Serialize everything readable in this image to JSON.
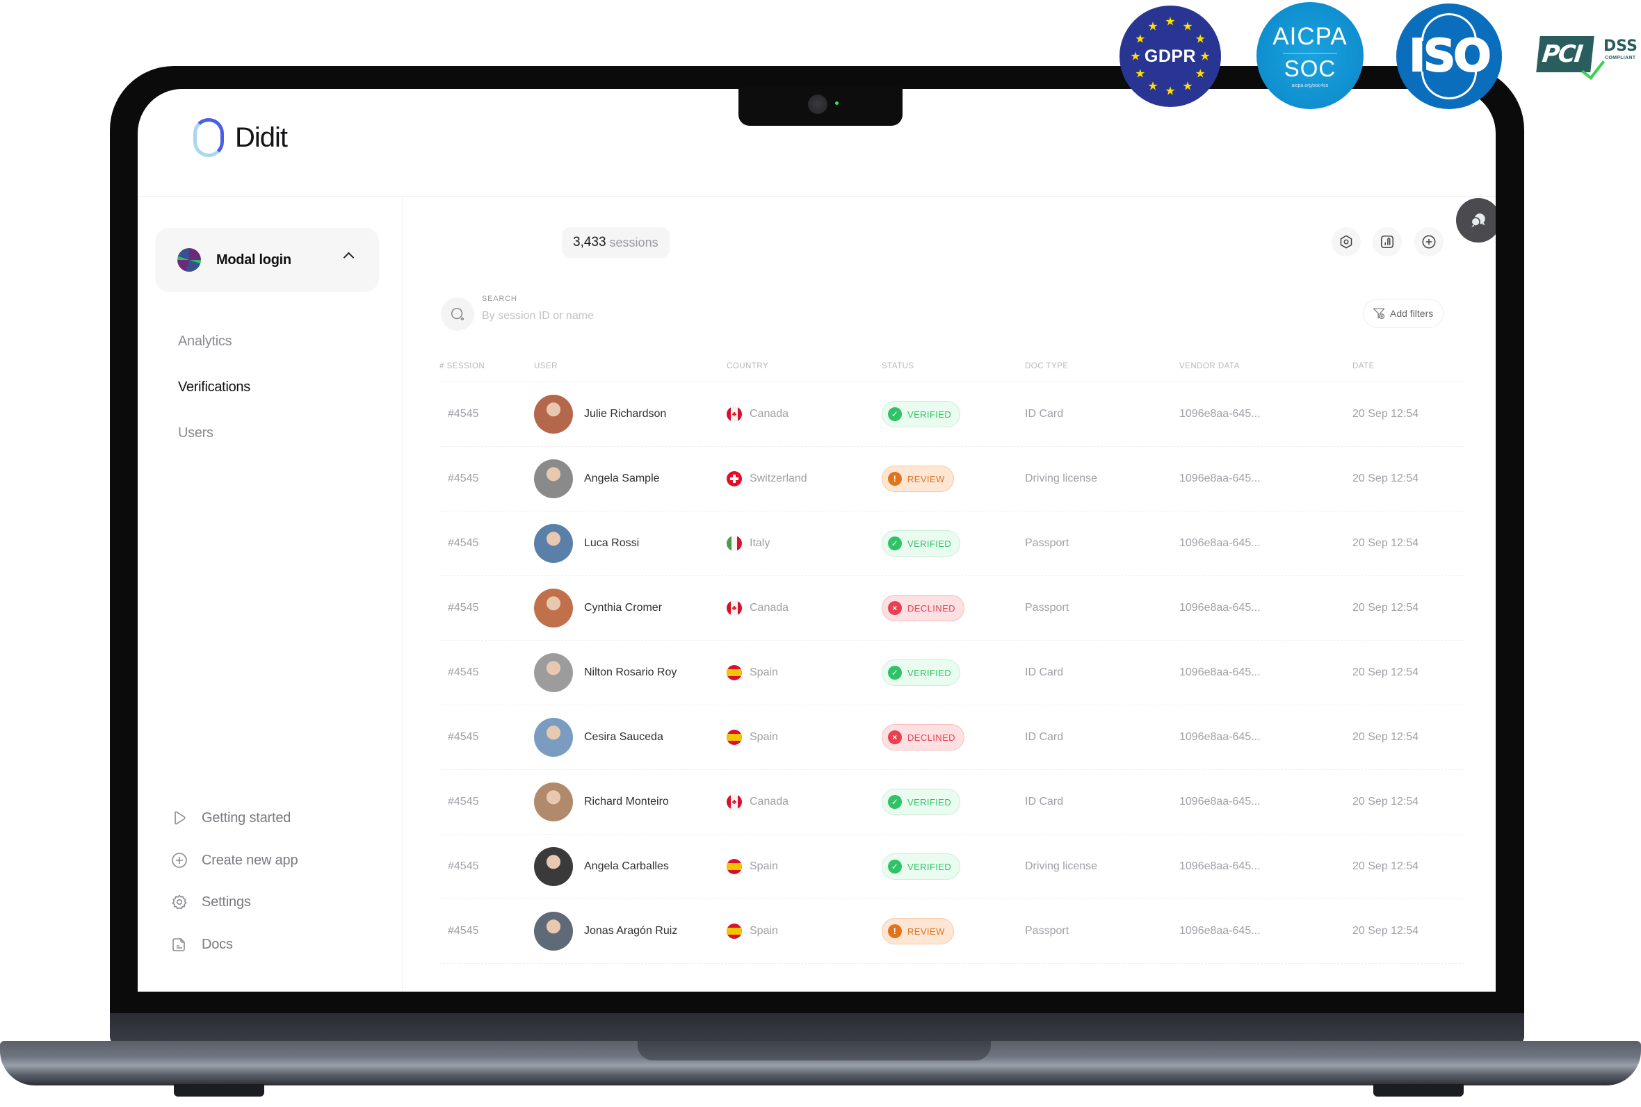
{
  "badges": {
    "gdpr": "GDPR",
    "aicpa_top": "AICPA",
    "aicpa_bottom": "SOC",
    "aicpa_url": "aicpa.org/soc4so",
    "iso": "ISO",
    "pci": "PCI",
    "pci_dss": "DSS",
    "pci_compliant": "COMPLIANT"
  },
  "brand": {
    "name": "Didit"
  },
  "sidebar": {
    "app_selector": {
      "name": "Modal login"
    },
    "nav": [
      {
        "label": "Analytics",
        "active": false
      },
      {
        "label": "Verifications",
        "active": true
      },
      {
        "label": "Users",
        "active": false
      }
    ],
    "bottom": [
      {
        "label": "Getting started",
        "icon": "play-icon"
      },
      {
        "label": "Create new app",
        "icon": "plus-circle-icon"
      },
      {
        "label": "Settings",
        "icon": "gear-icon"
      },
      {
        "label": "Docs",
        "icon": "document-icon"
      }
    ]
  },
  "main": {
    "sessions_count": "3,433",
    "sessions_label": "sessions",
    "search": {
      "label": "SEARCH",
      "placeholder": "By session ID or name",
      "value": ""
    },
    "add_filters_label": "Add filters",
    "columns": [
      "# SESSION",
      "USER",
      "COUNTRY",
      "STATUS",
      "DOC TYPE",
      "VENDOR DATA",
      "DATE"
    ],
    "rows": [
      {
        "session": "#4545",
        "user": "Julie Richardson",
        "country": "Canada",
        "flag": "ca",
        "status": "VERIFIED",
        "doc": "ID Card",
        "vendor": "1096e8aa-645...",
        "date": "20 Sep 12:54",
        "avatar_color": "#b4674a"
      },
      {
        "session": "#4545",
        "user": "Angela Sample",
        "country": "Switzerland",
        "flag": "ch",
        "status": "REVIEW",
        "doc": "Driving license",
        "vendor": "1096e8aa-645...",
        "date": "20 Sep 12:54",
        "avatar_color": "#8a8a8a"
      },
      {
        "session": "#4545",
        "user": "Luca Rossi",
        "country": "Italy",
        "flag": "it",
        "status": "VERIFIED",
        "doc": "Passport",
        "vendor": "1096e8aa-645...",
        "date": "20 Sep 12:54",
        "avatar_color": "#5a7fa8"
      },
      {
        "session": "#4545",
        "user": "Cynthia Cromer",
        "country": "Canada",
        "flag": "ca",
        "status": "DECLINED",
        "doc": "Passport",
        "vendor": "1096e8aa-645...",
        "date": "20 Sep 12:54",
        "avatar_color": "#c0704a"
      },
      {
        "session": "#4545",
        "user": "Nilton Rosario Roy",
        "country": "Spain",
        "flag": "es",
        "status": "VERIFIED",
        "doc": "ID Card",
        "vendor": "1096e8aa-645...",
        "date": "20 Sep 12:54",
        "avatar_color": "#9c9c9c"
      },
      {
        "session": "#4545",
        "user": "Cesira Sauceda",
        "country": "Spain",
        "flag": "es",
        "status": "DECLINED",
        "doc": "ID Card",
        "vendor": "1096e8aa-645...",
        "date": "20 Sep 12:54",
        "avatar_color": "#7a9cc0"
      },
      {
        "session": "#4545",
        "user": "Richard Monteiro",
        "country": "Canada",
        "flag": "ca",
        "status": "VERIFIED",
        "doc": "ID Card",
        "vendor": "1096e8aa-645...",
        "date": "20 Sep 12:54",
        "avatar_color": "#b08a6a"
      },
      {
        "session": "#4545",
        "user": "Angela Carballes",
        "country": "Spain",
        "flag": "es",
        "status": "VERIFIED",
        "doc": "Driving license",
        "vendor": "1096e8aa-645...",
        "date": "20 Sep 12:54",
        "avatar_color": "#3a3a3a"
      },
      {
        "session": "#4545",
        "user": "Jonas Aragón Ruiz",
        "country": "Spain",
        "flag": "es",
        "status": "REVIEW",
        "doc": "Passport",
        "vendor": "1096e8aa-645...",
        "date": "20 Sep 12:54",
        "avatar_color": "#5f6a78"
      }
    ]
  },
  "status_styles": {
    "VERIFIED": {
      "bg": "#eafbf0",
      "border": "#c9f0d7",
      "text": "#2fc266",
      "icon_bg": "#2fc266",
      "glyph": "✓"
    },
    "REVIEW": {
      "bg": "#fde6d3",
      "border": "#f7c9a3",
      "text": "#e0741c",
      "icon_bg": "#e0741c",
      "glyph": "!"
    },
    "DECLINED": {
      "bg": "#fde0e2",
      "border": "#f8bdc1",
      "text": "#e8404f",
      "icon_bg": "#e8404f",
      "glyph": "×"
    }
  },
  "colors": {
    "brand_blue": "#4a5ee8",
    "brand_light": "#a8d8f0"
  }
}
